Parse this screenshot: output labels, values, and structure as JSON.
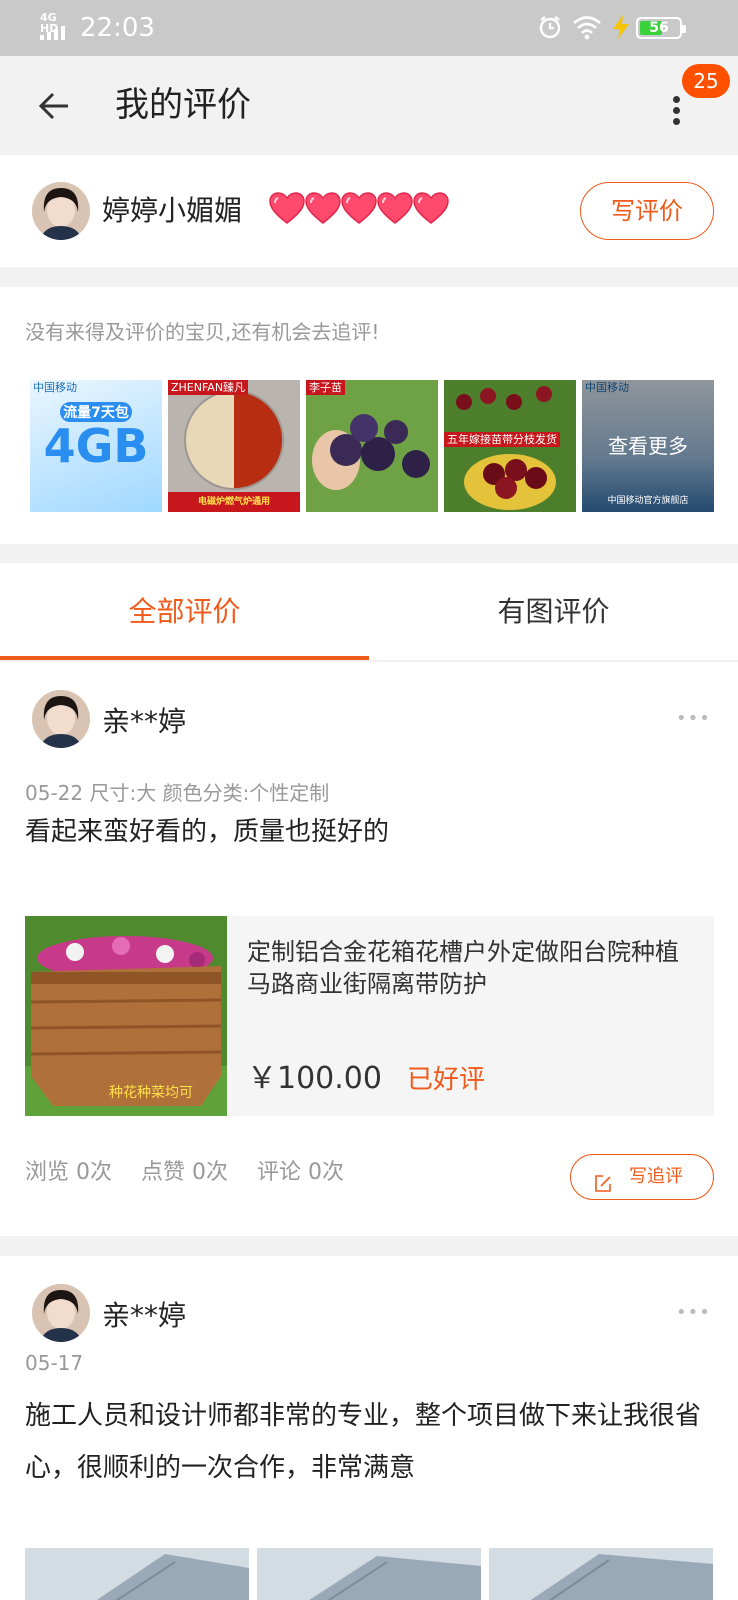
{
  "status_bar": {
    "network": "4G HD",
    "time": "22:03",
    "battery": "56",
    "battery_level": 0.56,
    "icons": [
      "signal-icon",
      "alarm-icon",
      "wifi-icon",
      "charging-icon",
      "battery-icon"
    ]
  },
  "header": {
    "title": "我的评价",
    "badge": "25",
    "icons": [
      "back-arrow-icon",
      "more-vertical-icon"
    ]
  },
  "profile": {
    "name": "婷婷小媚媚",
    "hearts_count": 5,
    "write_button": "写评价"
  },
  "pending": {
    "hint": "没有来得及评价的宝贝,还有机会去追评!",
    "thumbs": [
      {
        "tag": "中国移动",
        "big": "4GB",
        "sub": "流量7天包"
      },
      {
        "tag": "ZHENFAN臻凡",
        "sub": "电磁炉燃气炉通用"
      },
      {
        "tag": "李子苗"
      },
      {
        "tag": "五年嫁接苗带分枝发货"
      },
      {
        "tag": "中国移动",
        "more_label": "查看更多",
        "sub": "中国移动官方旗舰店"
      }
    ]
  },
  "tabs": {
    "all": "全部评价",
    "with_photos": "有图评价"
  },
  "reviews": [
    {
      "user": "亲**婷",
      "meta": "05-22  尺寸:大  颜色分类:个性定制",
      "content": "看起来蛮好看的，质量也挺好的",
      "product": {
        "name": "定制铝合金花箱花槽户外定做阳台院种植马路商业街隔离带防护",
        "price": "￥100.00",
        "status": "已好评",
        "image_caption": "种花种菜均可"
      },
      "stats": {
        "views": "浏览 0次",
        "likes": "点赞 0次",
        "comments": "评论 0次"
      },
      "followup_button": "写追评"
    },
    {
      "user": "亲**婷",
      "meta": "05-17",
      "content": "施工人员和设计师都非常的专业，整个项目做下来让我很省心，很顺利的一次合作，非常满意"
    }
  ],
  "colors": {
    "accent": "#f05a1a",
    "badge": "#ff5000",
    "statusbar": "#c9c9c9",
    "background": "#f2f2f2"
  }
}
